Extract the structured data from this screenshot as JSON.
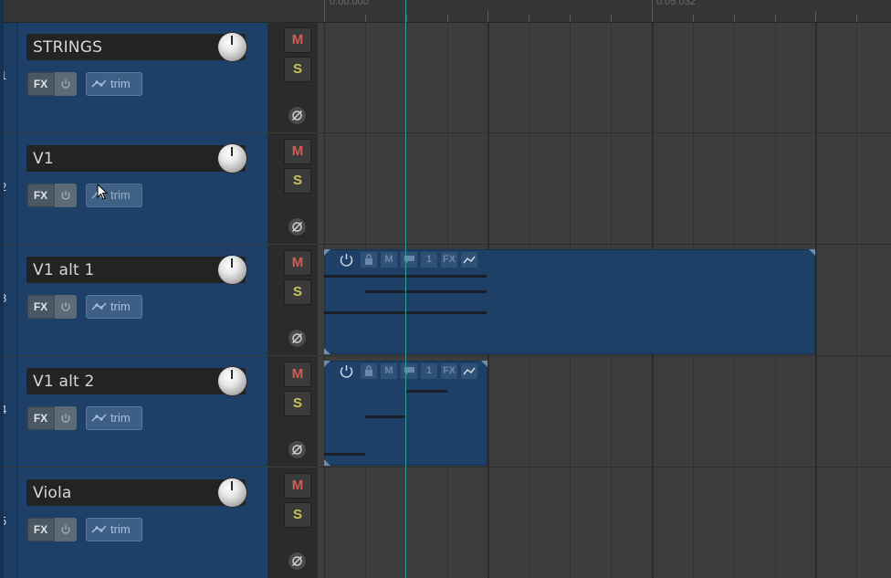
{
  "ruler": {
    "time_start": "0:00.000",
    "time_mid": "0:05.032"
  },
  "tracks": [
    {
      "number": "1",
      "name": "STRINGS",
      "fx_label": "FX",
      "trim_label": "trim",
      "mute_label": "M",
      "solo_label": "S"
    },
    {
      "number": "2",
      "name": "V1",
      "fx_label": "FX",
      "trim_label": "trim",
      "mute_label": "M",
      "solo_label": "S"
    },
    {
      "number": "3",
      "name": "V1 alt 1",
      "fx_label": "FX",
      "trim_label": "trim",
      "mute_label": "M",
      "solo_label": "S"
    },
    {
      "number": "4",
      "name": "V1 alt 2",
      "fx_label": "FX",
      "trim_label": "trim",
      "mute_label": "M",
      "solo_label": "S"
    },
    {
      "number": "5",
      "name": "Viola",
      "fx_label": "FX",
      "trim_label": "trim",
      "mute_label": "M",
      "solo_label": "S"
    }
  ],
  "items": [
    {
      "track": "V1 alt 1",
      "take_number": "1",
      "fx_label": "FX",
      "mute_label": "M"
    },
    {
      "track": "V1 alt 2",
      "take_number": "1",
      "fx_label": "FX",
      "mute_label": "M"
    }
  ],
  "colors": {
    "track_panel": "#1e4068",
    "media_item": "#1e3f66",
    "edit_cursor": "#2fa39a",
    "mute": "#d25c56",
    "solo": "#c9c25a"
  }
}
